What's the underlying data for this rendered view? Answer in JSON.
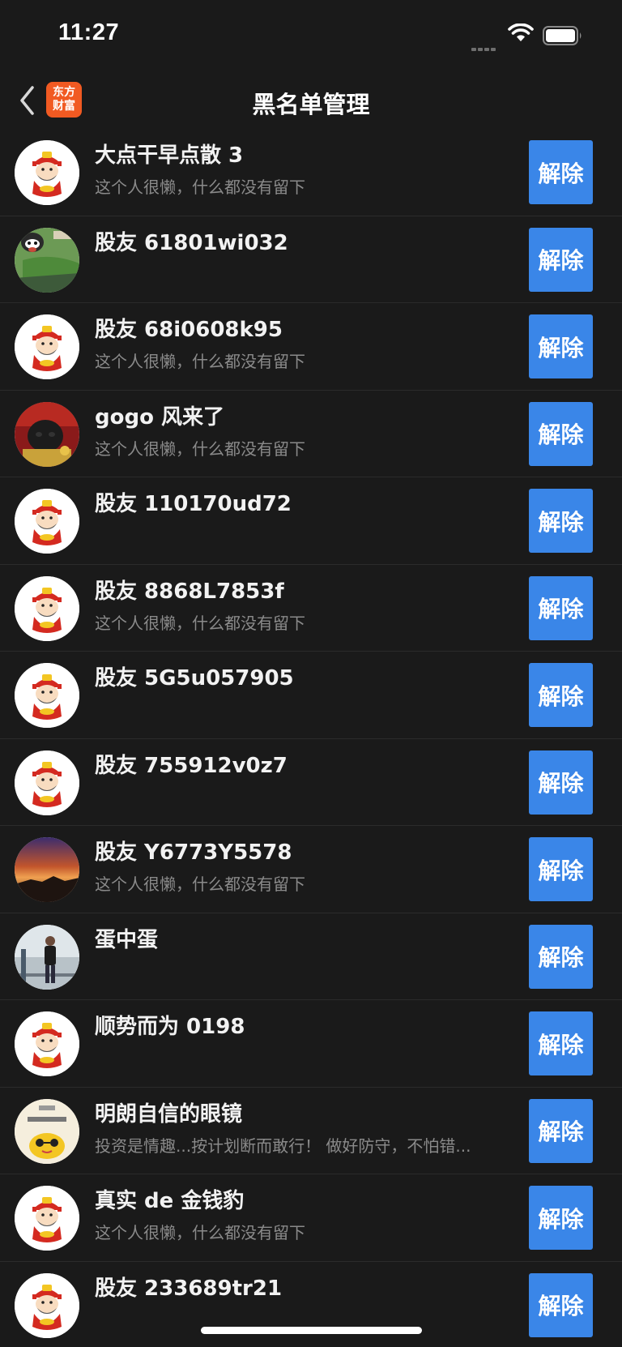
{
  "status_bar": {
    "time": "11:27"
  },
  "nav": {
    "title": "黑名单管理",
    "logo_line1": "东方",
    "logo_line2": "财富"
  },
  "unblock_label": "解除",
  "users": [
    {
      "name": "大点干早点散 3",
      "signature": "这个人很懒，什么都没有留下",
      "avatar": "mascot"
    },
    {
      "name": "股友 61801wi032",
      "signature": "",
      "avatar": "green-mascot"
    },
    {
      "name": "股友 68i0608k95",
      "signature": "这个人很懒，什么都没有留下",
      "avatar": "mascot"
    },
    {
      "name": "gogo 风来了",
      "signature": "这个人很懒，什么都没有留下",
      "avatar": "dog-photo"
    },
    {
      "name": "股友 110170ud72",
      "signature": "",
      "avatar": "mascot"
    },
    {
      "name": "股友 8868L7853f",
      "signature": "这个人很懒，什么都没有留下",
      "avatar": "mascot"
    },
    {
      "name": "股友 5G5u057905",
      "signature": "",
      "avatar": "mascot"
    },
    {
      "name": "股友 755912v0z7",
      "signature": "",
      "avatar": "mascot"
    },
    {
      "name": "股友 Y6773Y5578",
      "signature": "这个人很懒，什么都没有留下",
      "avatar": "sunset-photo"
    },
    {
      "name": "蛋中蛋",
      "signature": "",
      "avatar": "person-photo"
    },
    {
      "name": "顺势而为 0198",
      "signature": "",
      "avatar": "mascot"
    },
    {
      "name": "明朗自信的眼镜",
      "signature": "投资是情趣...按计划断而敢行！ 做好防守，不怕错...",
      "avatar": "cartoon-drawing"
    },
    {
      "name": "真实 de 金钱豹",
      "signature": "这个人很懒，什么都没有留下",
      "avatar": "mascot"
    },
    {
      "name": "股友 233689tr21",
      "signature": "",
      "avatar": "mascot"
    }
  ]
}
